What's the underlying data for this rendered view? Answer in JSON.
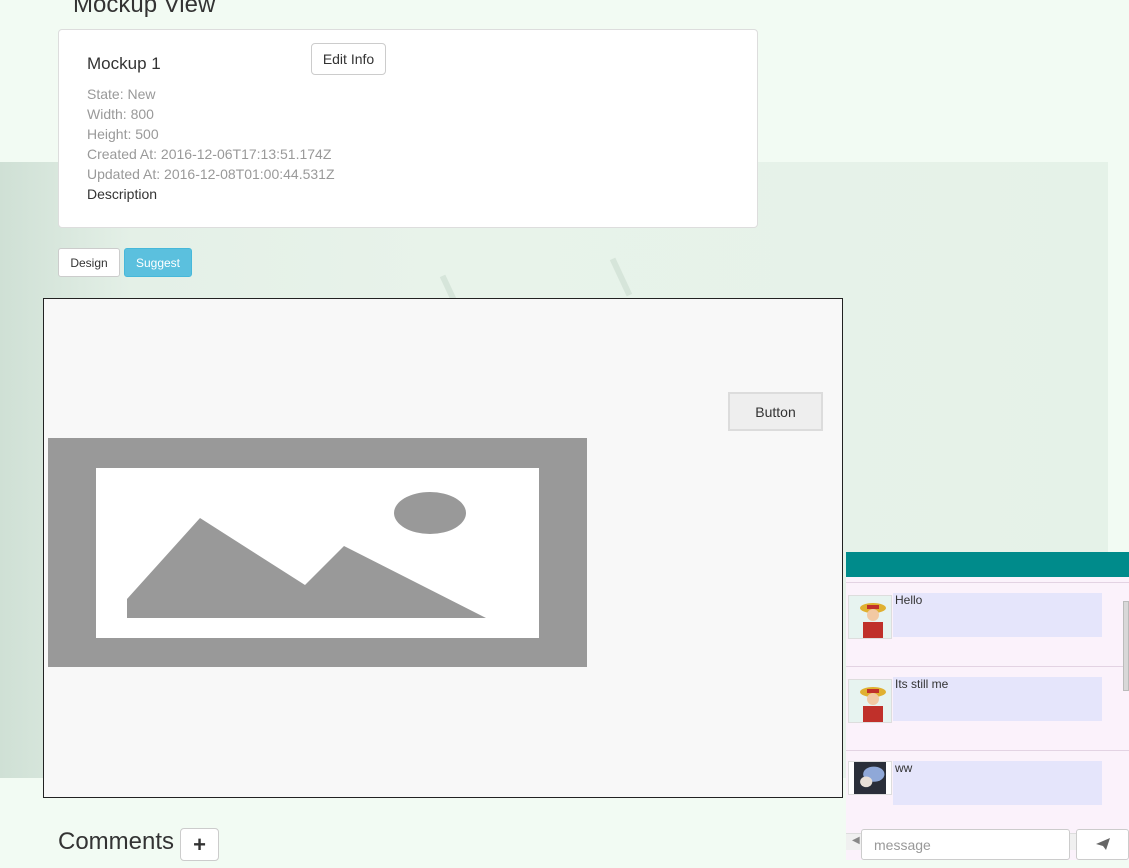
{
  "page": {
    "title": "Mockup View"
  },
  "mockup": {
    "name": "Mockup 1",
    "edit_label": "Edit Info",
    "state": "State: New",
    "width": "Width: 800",
    "height": "Height: 500",
    "created": "Created At: 2016-12-06T17:13:51.174Z",
    "updated": "Updated At: 2016-12-08T01:00:44.531Z",
    "description": "Description"
  },
  "tabs": [
    {
      "label": "Design",
      "active": false
    },
    {
      "label": "Suggest",
      "active": true
    }
  ],
  "canvas": {
    "button_label": "Button",
    "image_placeholder": "image-placeholder-icon"
  },
  "comments": {
    "title": "Comments",
    "add_label": "+"
  },
  "chat": {
    "header_color": "#008b8b",
    "messages": [
      {
        "text": "Hello",
        "avatar": "avatar-straw-hat-icon"
      },
      {
        "text": "Its still me",
        "avatar": "avatar-straw-hat-icon"
      },
      {
        "text": "ww",
        "avatar": "avatar-photo-icon"
      }
    ],
    "scroll_left": "◀",
    "scroll_right": "▶",
    "input_placeholder": "message",
    "send_icon": "send-icon"
  },
  "colors": {
    "suggest_active": "#5bc0de",
    "chat_header": "#008b8b",
    "bubble": "#e5e5fb"
  }
}
